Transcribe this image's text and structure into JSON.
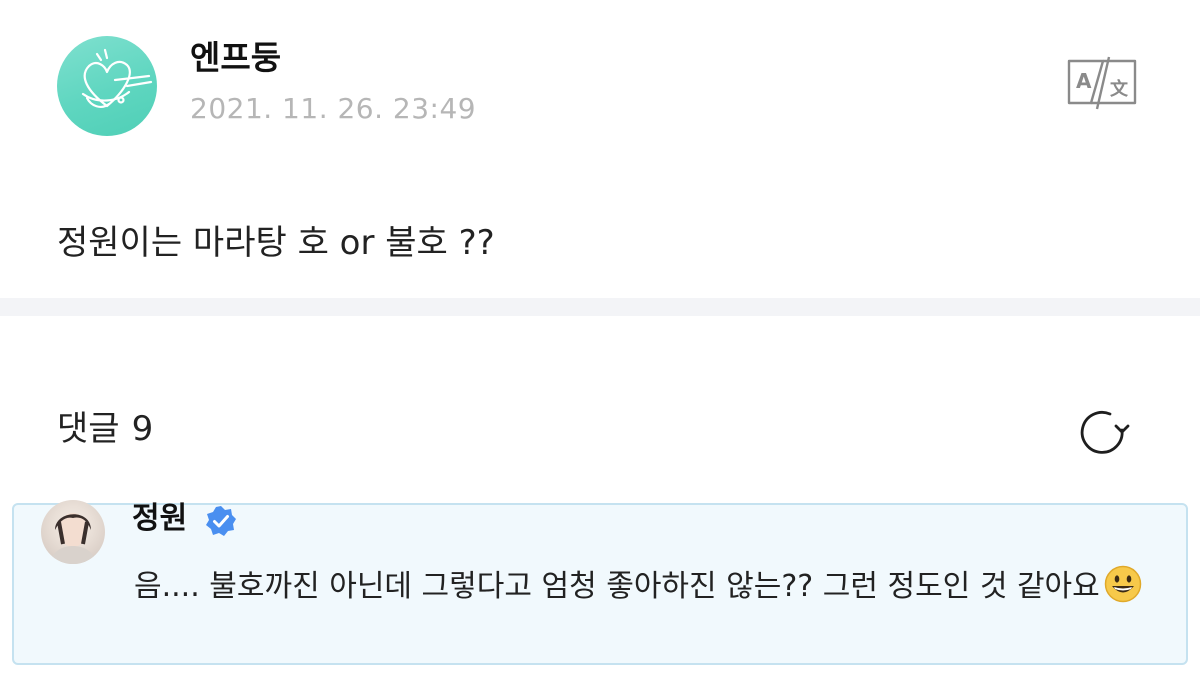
{
  "post": {
    "author": "엔프둥",
    "timestamp": "2021. 11. 26. 23:49",
    "body": "정원이는 마라탕 호 or 불호 ??",
    "avatar_icon": "heart-doodle-avatar",
    "translate_icon": "translate-icon"
  },
  "comments": {
    "title": "댓글",
    "count": "9",
    "refresh_icon": "refresh-icon",
    "items": [
      {
        "author": "정원",
        "verified": true,
        "text": "음.... 불호까진 아닌데 그렇다고 엄청 좋아하진 않는?? 그런 정도인 것 같아요",
        "emoji": "grinning-face-emoji"
      }
    ]
  },
  "colors": {
    "accent_teal": "#5fd6c0",
    "verified_blue": "#4a8ff0",
    "timestamp_gray": "#b6b6b6",
    "highlight_bg": "#f1f9fd",
    "highlight_border": "#c5e2f0"
  }
}
